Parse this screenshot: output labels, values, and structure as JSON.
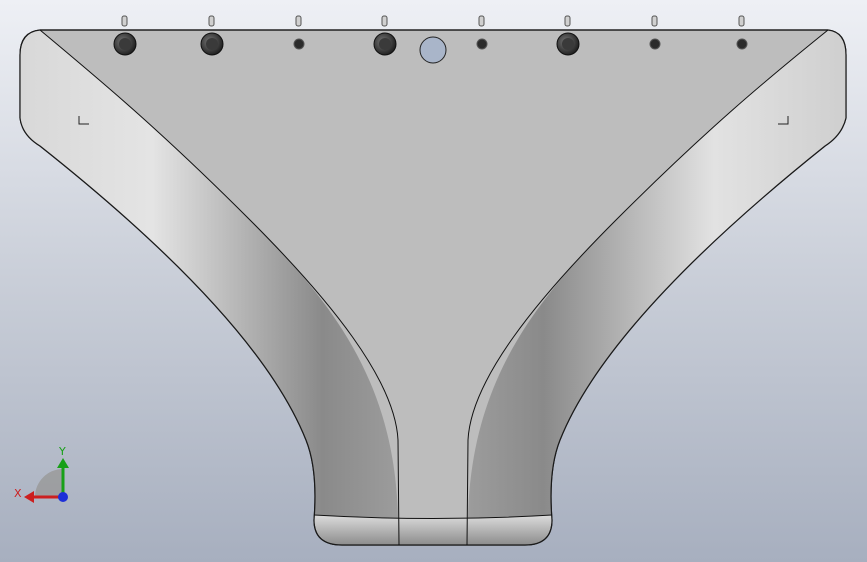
{
  "viewport": {
    "triad": {
      "x_label": "X",
      "y_label": "Y",
      "x_color": "#cc1f1f",
      "y_color": "#18a018",
      "z_color": "#1d2fd8"
    },
    "part": {
      "body_color": "#bcbcbc",
      "edge_color": "#111111",
      "port_hole_color": "#a9b5c9",
      "large_fastener_count": 4,
      "small_fastener_count": 4,
      "corner_markers": 2
    }
  }
}
